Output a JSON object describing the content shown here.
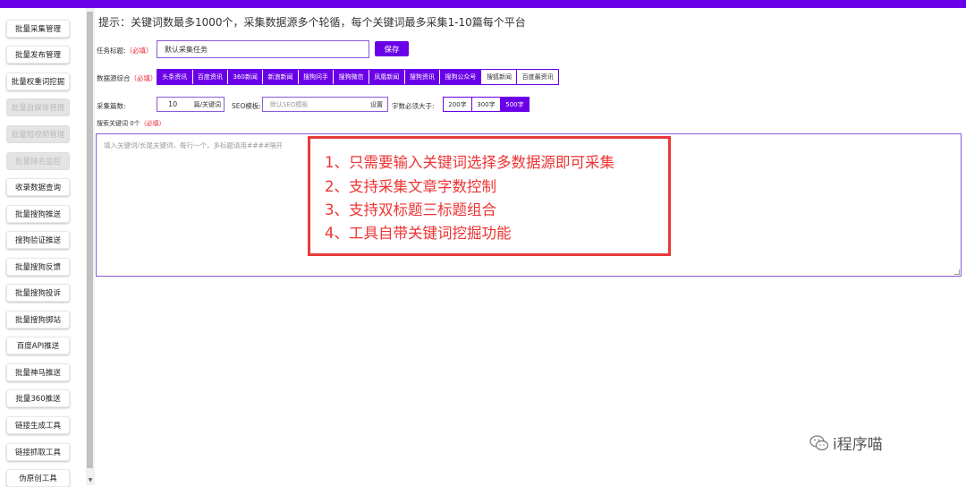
{
  "sidebar": {
    "items": [
      {
        "label": "批量采集管理",
        "disabled": false
      },
      {
        "label": "批量发布管理",
        "disabled": false
      },
      {
        "label": "批量权重词挖掘",
        "disabled": false
      },
      {
        "label": "批量自媒体管理",
        "disabled": true
      },
      {
        "label": "批量短视频管理",
        "disabled": true
      },
      {
        "label": "批量排名监控",
        "disabled": true
      },
      {
        "label": "收录数据查询",
        "disabled": false
      },
      {
        "label": "批量搜狗推送",
        "disabled": false
      },
      {
        "label": "搜狗验证推送",
        "disabled": false
      },
      {
        "label": "批量搜狗反馈",
        "disabled": false
      },
      {
        "label": "批量搜狗投诉",
        "disabled": false
      },
      {
        "label": "批量搜狗掷站",
        "disabled": false
      },
      {
        "label": "百度API推送",
        "disabled": false
      },
      {
        "label": "批量神马推送",
        "disabled": false
      },
      {
        "label": "批量360推送",
        "disabled": false
      },
      {
        "label": "链接生成工具",
        "disabled": false
      },
      {
        "label": "链接抓取工具",
        "disabled": false
      },
      {
        "label": "伪原创工具",
        "disabled": false
      }
    ]
  },
  "tip": "提示：关键词数最多1000个，采集数据源多个轮循，每个关键词最多采集1-10篇每个平台",
  "task": {
    "label": "任务标题:",
    "required": "（必填）",
    "value": "默认采集任务",
    "save_label": "保存"
  },
  "sources": {
    "label": "数据源综合",
    "required": "（必填）",
    "options": [
      {
        "label": "头条资讯",
        "on": true
      },
      {
        "label": "百度资讯",
        "on": true
      },
      {
        "label": "360新闻",
        "on": true
      },
      {
        "label": "新浪新闻",
        "on": true
      },
      {
        "label": "搜狗问手",
        "on": true
      },
      {
        "label": "搜狗微信",
        "on": true
      },
      {
        "label": "凤凰新闻",
        "on": true
      },
      {
        "label": "搜狗资讯",
        "on": true
      },
      {
        "label": "搜狗公众号",
        "on": true
      },
      {
        "label": "搜狐新闻",
        "on": false
      },
      {
        "label": "百度最资讯",
        "on": false
      }
    ]
  },
  "collect": {
    "count_label": "采集篇数:",
    "count_value": "10",
    "count_unit": "篇/关键词",
    "seo_label": "SEO模板:",
    "seo_placeholder": "默认SEO模板",
    "seo_set": "设置",
    "words_label": "字数必须大于:",
    "words_options": [
      {
        "label": "200字",
        "on": false
      },
      {
        "label": "300字",
        "on": false
      },
      {
        "label": "500字",
        "on": true
      }
    ]
  },
  "keywords": {
    "label": "搜索关键词 0个",
    "required": "（必填）",
    "placeholder": "填入关键词/长尾关键词，每行一个，多标题请用####隔开"
  },
  "callout": {
    "lines": [
      "1、只需要输入关键词选择多数据源即可采集",
      "2、支持采集文章字数控制",
      "3、支持双标题三标题组合",
      "4、工具自带关键词挖掘功能"
    ]
  },
  "watermark": {
    "icon": "wechat-icon",
    "text": "i程序喵"
  },
  "colors": {
    "accent": "#6a00e8",
    "callout": "#e83a3a"
  }
}
